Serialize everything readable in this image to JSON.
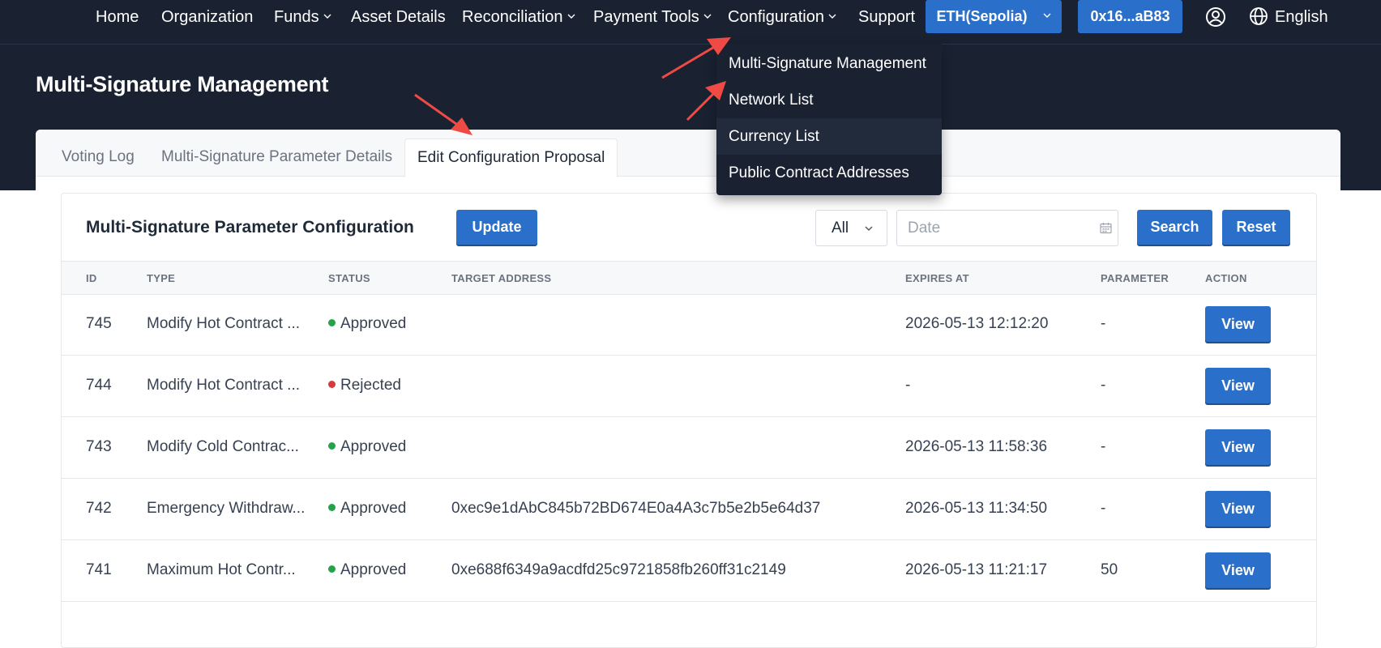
{
  "nav": {
    "items": [
      {
        "label": "Home",
        "dropdown": false
      },
      {
        "label": "Organization",
        "dropdown": false
      },
      {
        "label": "Funds",
        "dropdown": true
      },
      {
        "label": "Asset Details",
        "dropdown": false
      },
      {
        "label": "Reconciliation",
        "dropdown": true
      },
      {
        "label": "Payment Tools",
        "dropdown": true
      },
      {
        "label": "Configuration",
        "dropdown": true
      },
      {
        "label": "Support",
        "dropdown": false
      }
    ],
    "network_button": "ETH(Sepolia)",
    "wallet_button": "0x16...aB83",
    "language": "English",
    "icons": {
      "user": "user-circle-icon",
      "language": "globe-icon"
    }
  },
  "configuration_menu": {
    "items": [
      "Multi-Signature Management",
      "Network List",
      "Currency List",
      "Public Contract Addresses"
    ],
    "highlighted_index": 2
  },
  "page": {
    "title": "Multi-Signature Management"
  },
  "tabs": {
    "items": [
      "Voting Log",
      "Multi-Signature Parameter Details",
      "Edit Configuration Proposal"
    ],
    "active_index": 2
  },
  "panel": {
    "title": "Multi-Signature Parameter Configuration",
    "update_label": "Update",
    "filter_value": "All",
    "date_placeholder": "Date",
    "search_label": "Search",
    "reset_label": "Reset"
  },
  "table": {
    "columns": [
      "ID",
      "TYPE",
      "STATUS",
      "TARGET ADDRESS",
      "EXPIRES AT",
      "PARAMETER",
      "ACTION"
    ],
    "rows": [
      {
        "id": "745",
        "type": "Modify Hot Contract ...",
        "status": "Approved",
        "target": "",
        "expires": "2026-05-13 12:12:20",
        "parameter": "-",
        "action": "View"
      },
      {
        "id": "744",
        "type": "Modify Hot Contract ...",
        "status": "Rejected",
        "target": "",
        "expires": "-",
        "parameter": "-",
        "action": "View"
      },
      {
        "id": "743",
        "type": "Modify Cold Contrac...",
        "status": "Approved",
        "target": "",
        "expires": "2026-05-13 11:58:36",
        "parameter": "-",
        "action": "View"
      },
      {
        "id": "742",
        "type": "Emergency Withdraw...",
        "status": "Approved",
        "target": "0xec9e1dAbC845b72BD674E0a4A3c7b5e2b5e64d37",
        "expires": "2026-05-13 11:34:50",
        "parameter": "-",
        "action": "View"
      },
      {
        "id": "741",
        "type": "Maximum Hot Contr...",
        "status": "Approved",
        "target": "0xe688f6349a9acdfd25c9721858fb260ff31c2149",
        "expires": "2026-05-13 11:21:17",
        "parameter": "50",
        "action": "View"
      }
    ]
  },
  "colors": {
    "header_bg": "#1a2232",
    "primary": "#2a6fc9",
    "approved": "#22a34a",
    "rejected": "#d63a3a",
    "annotation_arrow": "#ef4a44"
  }
}
